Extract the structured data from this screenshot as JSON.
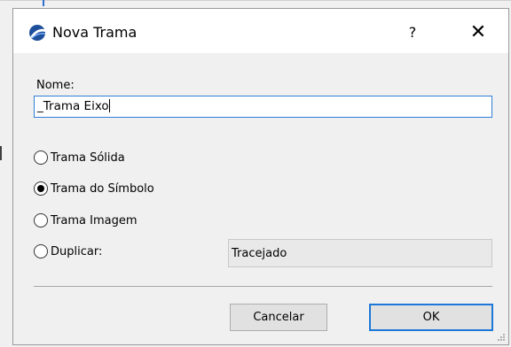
{
  "window": {
    "title": "Nova Trama",
    "help_label": "?",
    "close_label": "✕"
  },
  "form": {
    "name_label": "Nome:",
    "name_value": "_Trama Eixo",
    "options": [
      {
        "label": "Trama Sólida",
        "selected": false
      },
      {
        "label": "Trama do Símbolo",
        "selected": true
      },
      {
        "label": "Trama Imagem",
        "selected": false
      },
      {
        "label": "Duplicar:",
        "selected": false
      }
    ],
    "duplicate_value": "Tracejado"
  },
  "buttons": {
    "cancel": "Cancelar",
    "ok": "OK"
  },
  "colors": {
    "focus_blue": "#2f7fd6",
    "dialog_bg": "#f0f0f0"
  }
}
